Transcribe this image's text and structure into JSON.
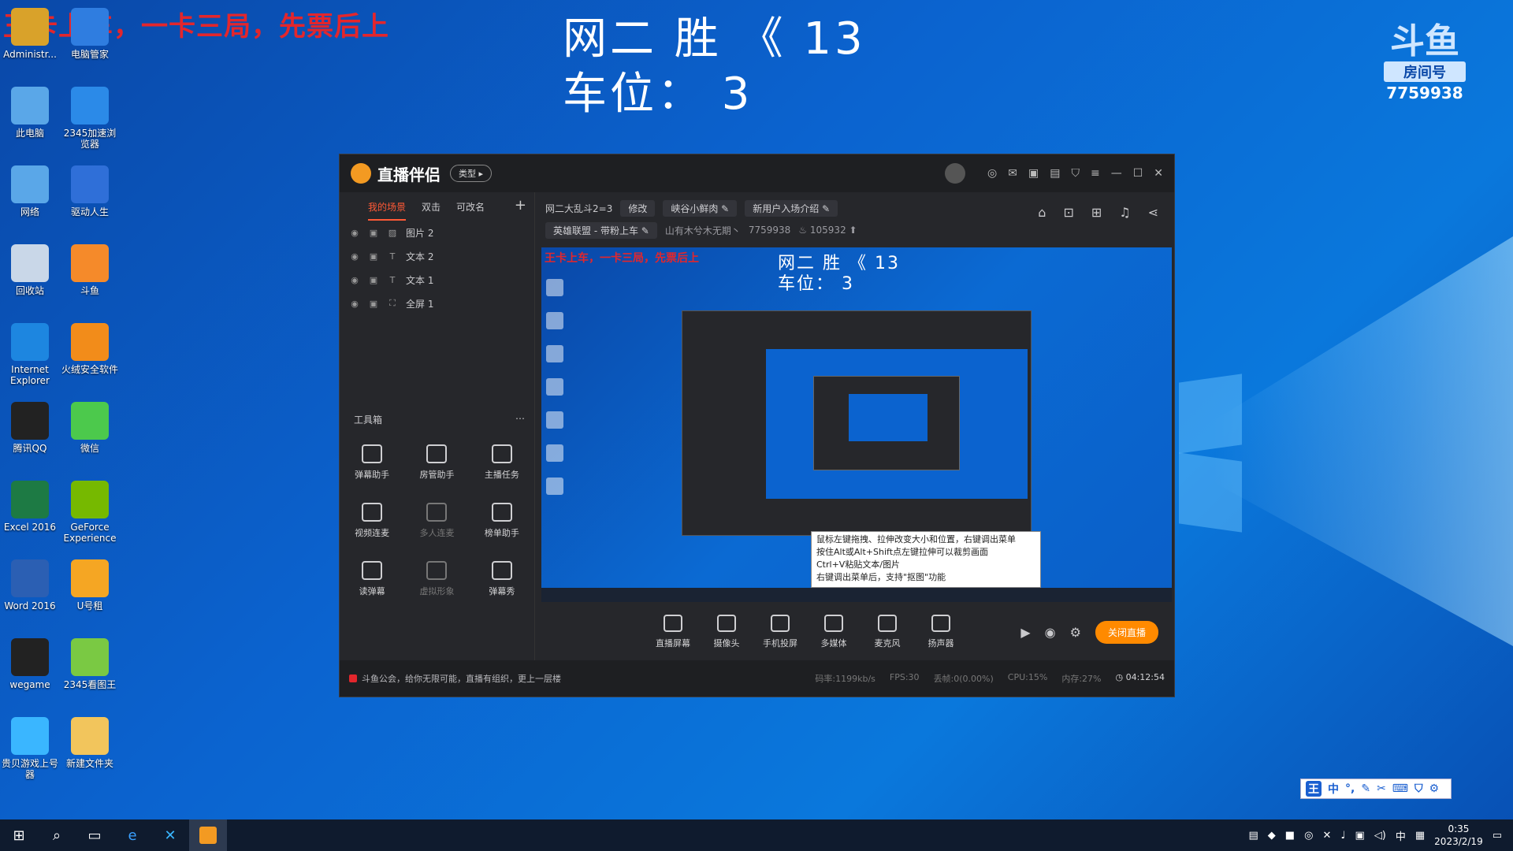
{
  "desktop": {
    "overlay_text": "王卡上车，一卡三局，先票后上",
    "score_line1": "网二   胜 《 13",
    "score_line2": "车位：  3",
    "room_badge": "房间号",
    "room_number": "7759938",
    "icons": [
      {
        "label": "Administr...",
        "icon": "user-folder-icon",
        "color": "#d9a22a"
      },
      {
        "label": "电脑管家",
        "icon": "shield-icon",
        "color": "#2f7de0"
      },
      {
        "label": "此电脑",
        "icon": "computer-icon",
        "color": "#5aa7e8"
      },
      {
        "label": "2345加速浏览器",
        "icon": "browser-e-icon",
        "color": "#2b8ae8"
      },
      {
        "label": "网络",
        "icon": "network-icon",
        "color": "#5aa7e8"
      },
      {
        "label": "驱动人生",
        "icon": "gear-icon",
        "color": "#2f6fd8"
      },
      {
        "label": "回收站",
        "icon": "recycle-bin-icon",
        "color": "#c9d7e8"
      },
      {
        "label": "斗鱼",
        "icon": "douyu-fish-icon",
        "color": "#f58a2a"
      },
      {
        "label": "Internet Explorer",
        "icon": "ie-icon",
        "color": "#1d86e0"
      },
      {
        "label": "火绒安全软件",
        "icon": "flame-icon",
        "color": "#f28c1a"
      },
      {
        "label": "腾讯QQ",
        "icon": "qq-penguin-icon",
        "color": "#222222"
      },
      {
        "label": "微信",
        "icon": "wechat-icon",
        "color": "#4cc94c"
      },
      {
        "label": "Excel 2016",
        "icon": "excel-icon",
        "color": "#1d7a44"
      },
      {
        "label": "GeForce Experience",
        "icon": "nvidia-icon",
        "color": "#76b900"
      },
      {
        "label": "Word 2016",
        "icon": "word-icon",
        "color": "#2b5fb3"
      },
      {
        "label": "U号租",
        "icon": "rent-icon",
        "color": "#f5a623"
      },
      {
        "label": "wegame",
        "icon": "wegame-icon",
        "color": "#222222"
      },
      {
        "label": "2345看图王",
        "icon": "image-viewer-icon",
        "color": "#7ac943"
      },
      {
        "label": "贵贝游戏上号器",
        "icon": "game-login-icon",
        "color": "#3ab6ff"
      },
      {
        "label": "新建文件夹",
        "icon": "folder-icon",
        "color": "#f2c55c"
      }
    ]
  },
  "app": {
    "title": "直播伴侣",
    "type_pill": "类型",
    "scene_tabs": [
      "我的场景",
      "双击",
      "可改名"
    ],
    "add_label": "+",
    "layers": [
      {
        "type": "image",
        "name": "图片 2"
      },
      {
        "type": "text",
        "name": "文本 2"
      },
      {
        "type": "text",
        "name": "文本 1"
      },
      {
        "type": "screen",
        "name": "全屏 1"
      }
    ],
    "toolbox_label": "工具箱",
    "tools": [
      {
        "label": "弹幕助手",
        "dim": false
      },
      {
        "label": "房管助手",
        "dim": false
      },
      {
        "label": "主播任务",
        "dim": false
      },
      {
        "label": "视频连麦",
        "dim": false
      },
      {
        "label": "多人连麦",
        "dim": true
      },
      {
        "label": "榜单助手",
        "dim": false
      },
      {
        "label": "读弹幕",
        "dim": false
      },
      {
        "label": "虚拟形象",
        "dim": true
      },
      {
        "label": "弹幕秀",
        "dim": false
      }
    ],
    "stream": {
      "title": "网二大乱斗2=3",
      "edit_label": "修改",
      "tag1": "峡谷小鲜肉",
      "tag2": "新用户入场介绍",
      "category": "英雄联盟 - 带粉上车",
      "location": "山有木兮木无期丶",
      "room_id": "7759938",
      "heat": "105932"
    },
    "preview": {
      "mini_red": "王卡上车，一卡三局，先票后上",
      "mini_score1": "网二   胜 《 13",
      "mini_score2": "车位：  3",
      "tooltip": [
        "鼠标左键拖拽、拉伸改变大小和位置，右键调出菜单",
        "按住Alt或Alt+Shift点左键拉伸可以裁剪画面",
        "Ctrl+V粘贴文本/图片",
        "右键调出菜单后，支持\"抠图\"功能"
      ]
    },
    "controls": [
      "直播屏幕",
      "摄像头",
      "手机投屏",
      "多媒体",
      "麦克风",
      "扬声器"
    ],
    "end_button": "关闭直播",
    "status": {
      "notice": "斗鱼公会，给你无限可能，直播有组织，更上一层楼",
      "bitrate": "码率:1199kb/s",
      "fps": "FPS:30",
      "dropped": "丢帧:0(0.00%)",
      "cpu": "CPU:15%",
      "mem": "内存:27%",
      "time": "04:12:54"
    }
  },
  "ime": {
    "mode": "中"
  },
  "taskbar": {
    "clock_time": "0:35",
    "clock_date": "2023/2/19",
    "tray_lang": "中"
  }
}
